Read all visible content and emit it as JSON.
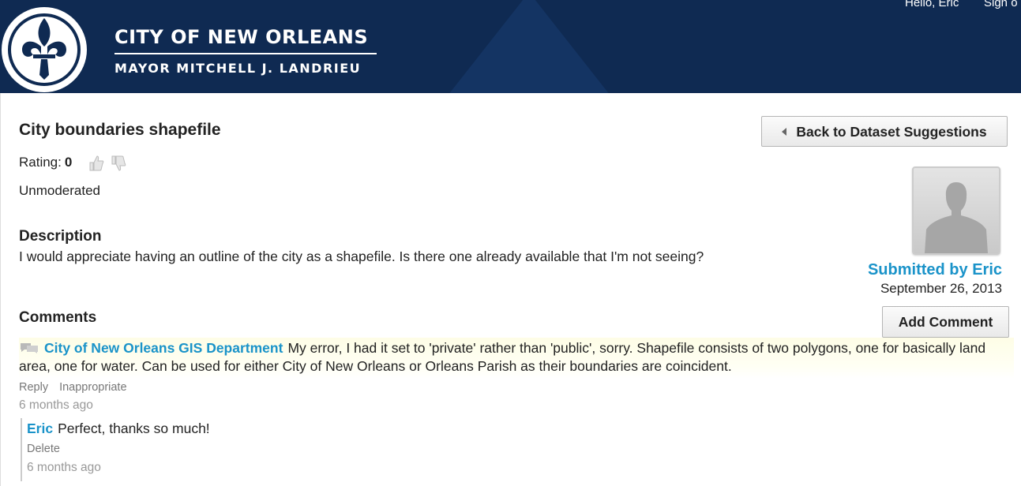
{
  "header": {
    "city_name": "CITY OF NEW ORLEANS",
    "mayor": "MAYOR MITCHELL J. LANDRIEU",
    "greeting": "Hello, Eric",
    "sign_out": "Sign o",
    "colors": {
      "navy": "#0f2a52",
      "link": "#1a93c9"
    }
  },
  "suggestion": {
    "title": "City boundaries shapefile",
    "rating_label": "Rating:",
    "rating_value": "0",
    "status": "Unmoderated",
    "description_heading": "Description",
    "description": "I would appreciate having an outline of the city as a shapefile. Is there one already available that I'm not seeing?"
  },
  "sidebar": {
    "back_label": "Back to Dataset Suggestions",
    "submitted_by": "Submitted by Eric",
    "submitted_date": "September 26, 2013",
    "avatar_icon": "person-silhouette-icon"
  },
  "comments": {
    "heading": "Comments",
    "add_label": "Add Comment",
    "items": [
      {
        "author": "City of New Orleans GIS Department",
        "text": "My error, I had it set to 'private' rather than 'public', sorry. Shapefile consists of two polygons, one for basically land area, one for water. Can be used for either City of New Orleans or Orleans Parish as their boundaries are coincident.",
        "reply_label": "Reply",
        "inappropriate_label": "Inappropriate",
        "time": "6 months ago",
        "icon": "speech-bubble-icon"
      }
    ],
    "replies": [
      {
        "author": "Eric",
        "text": "Perfect, thanks so much!",
        "delete_label": "Delete",
        "time": "6 months ago"
      }
    ]
  }
}
